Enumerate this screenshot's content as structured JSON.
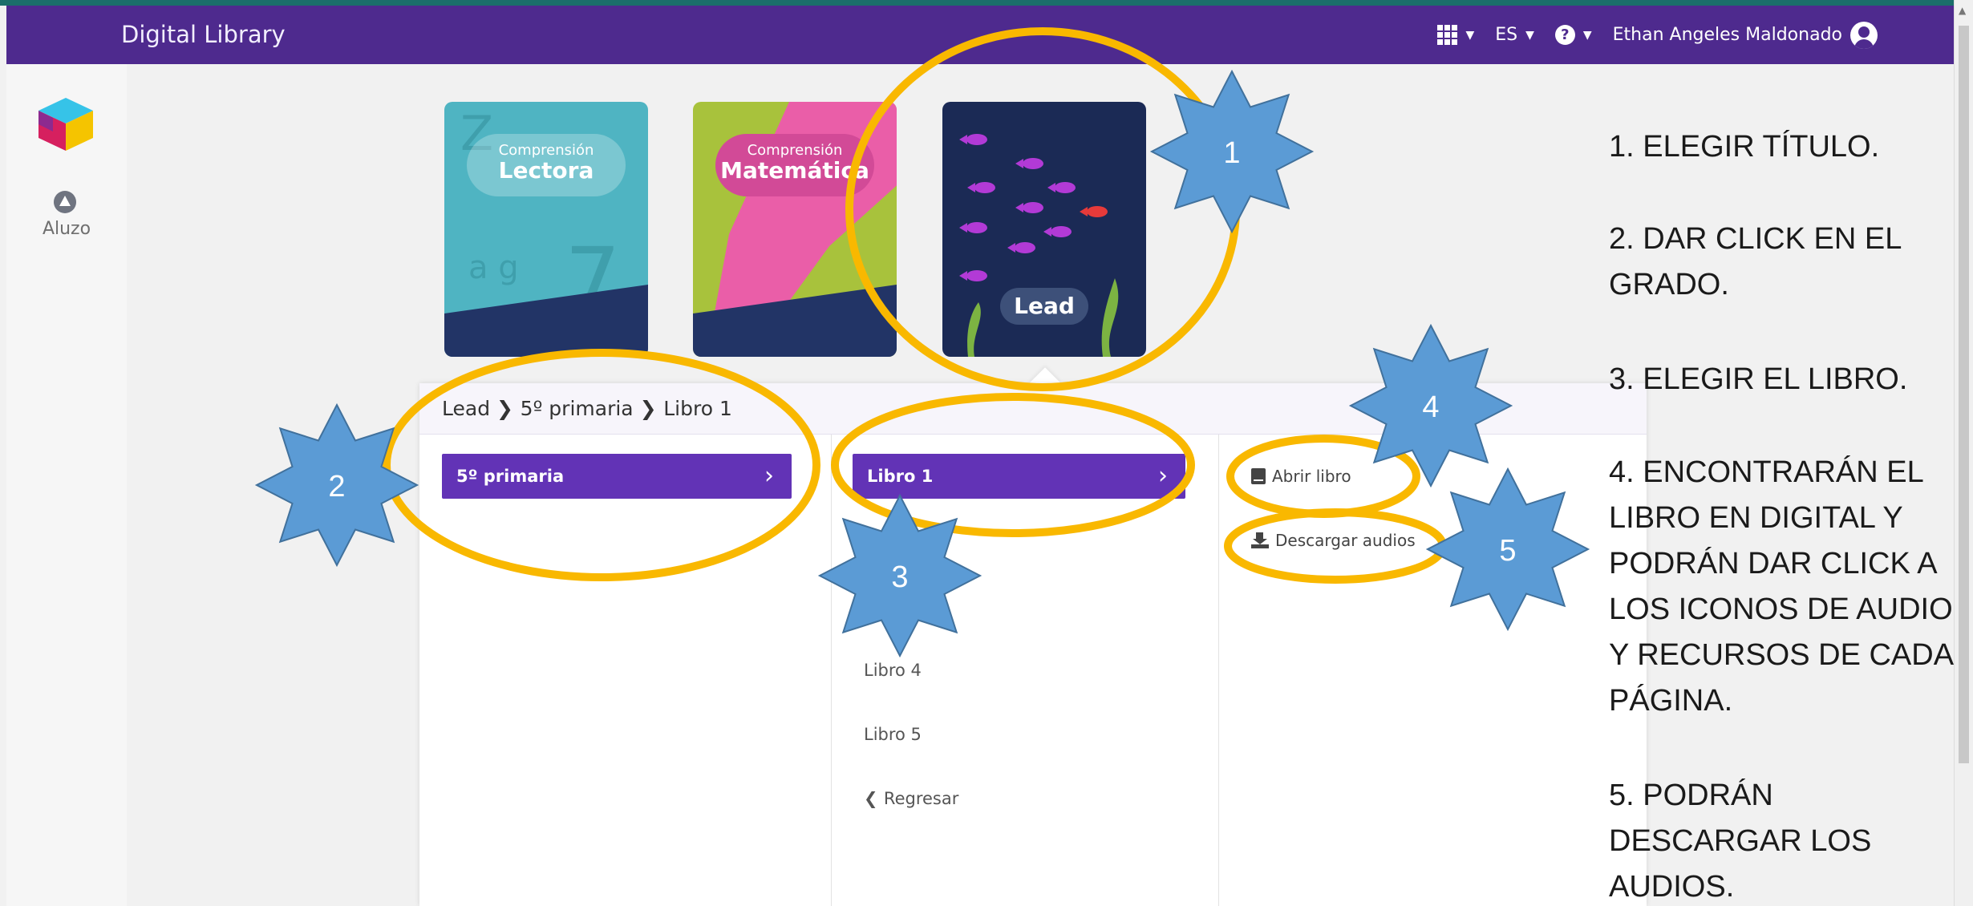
{
  "header": {
    "brand": "Digital Library",
    "lang": "ES",
    "user_name": "Ethan Angeles Maldonado"
  },
  "sidebar": {
    "app_label": "Aluzo"
  },
  "books": [
    {
      "subtitle": "Comprensión",
      "title": "Lectora"
    },
    {
      "subtitle": "Comprensión",
      "title": "Matemática"
    },
    {
      "title": "Lead"
    }
  ],
  "panel": {
    "breadcrumb": [
      "Lead",
      "5º primaria",
      "Libro 1"
    ],
    "grades": [
      "5º primaria"
    ],
    "books": [
      "Libro 1",
      "Libro 4",
      "Libro 5"
    ],
    "back_label": "Regresar",
    "open_book": "Abrir libro",
    "download_audio": "Descargar audios"
  },
  "annotations": {
    "markers": [
      "1",
      "2",
      "3",
      "4",
      "5"
    ],
    "instructions": [
      "1. ELEGIR TÍTULO.",
      "2. DAR CLICK EN EL GRADO.",
      "3. ELEGIR EL LIBRO.",
      "4. ENCONTRARÁN EL LIBRO EN DIGITAL Y PODRÁN DAR CLICK A LOS ICONOS DE AUDIO Y RECURSOS DE CADA PÁGINA.",
      "5. PODRÁN DESCARGAR LOS AUDIOS."
    ]
  },
  "colors": {
    "navbar": "#4e2a8e",
    "button": "#6233b6",
    "highlight_ring": "#f9b800",
    "marker_star": "#5b9bd5"
  }
}
